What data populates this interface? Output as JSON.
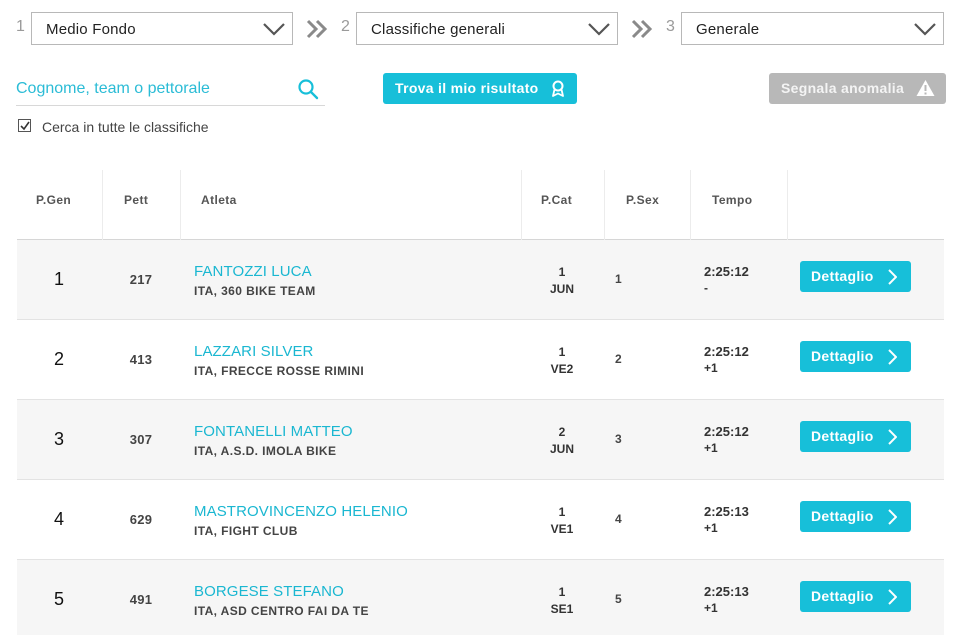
{
  "steps": [
    {
      "number": "1",
      "selected": "Medio Fondo"
    },
    {
      "number": "2",
      "selected": "Classifiche generali"
    },
    {
      "number": "3",
      "selected": "Generale"
    }
  ],
  "search": {
    "placeholder": "Cognome, team o pettorale",
    "value": "",
    "icon": "search-icon"
  },
  "actions": {
    "find_label": "Trova il mio risultato",
    "find_icon": "award-ribbon-icon",
    "report_label": "Segnala anomalia",
    "report_icon": "warning-triangle-icon"
  },
  "filter": {
    "checked": true,
    "label": "Cerca in tutte le classifiche"
  },
  "table": {
    "headers": {
      "pgen": "P.Gen",
      "pett": "Pett",
      "atleta": "Atleta",
      "pcat": "P.Cat",
      "psex": "P.Sex",
      "tempo": "Tempo"
    },
    "detail_label": "Dettaglio",
    "rows": [
      {
        "pgen": "1",
        "pett": "217",
        "name": "FANTOZZI LUCA",
        "team": "ITA, 360 BIKE TEAM",
        "pcat": "1",
        "cat": "JUN",
        "psex": "1",
        "time": "2:25:12",
        "gap": "-"
      },
      {
        "pgen": "2",
        "pett": "413",
        "name": "LAZZARI SILVER",
        "team": "ITA, FRECCE ROSSE RIMINI",
        "pcat": "1",
        "cat": "VE2",
        "psex": "2",
        "time": "2:25:12",
        "gap": "+1"
      },
      {
        "pgen": "3",
        "pett": "307",
        "name": "FONTANELLI MATTEO",
        "team": "ITA, A.S.D. IMOLA BIKE",
        "pcat": "2",
        "cat": "JUN",
        "psex": "3",
        "time": "2:25:12",
        "gap": "+1"
      },
      {
        "pgen": "4",
        "pett": "629",
        "name": "MASTROVINCENZO HELENIO",
        "team": "ITA, FIGHT CLUB",
        "pcat": "1",
        "cat": "VE1",
        "psex": "4",
        "time": "2:25:13",
        "gap": "+1"
      },
      {
        "pgen": "5",
        "pett": "491",
        "name": "BORGESE STEFANO",
        "team": "ITA, ASD CENTRO FAI DA TE",
        "pcat": "1",
        "cat": "SE1",
        "psex": "5",
        "time": "2:25:13",
        "gap": "+1"
      }
    ]
  },
  "colors": {
    "accent": "#17bfd9",
    "link": "#1ab7d1",
    "disabled_button": "#b8b8b8",
    "row_alt": "#f6f6f6"
  }
}
